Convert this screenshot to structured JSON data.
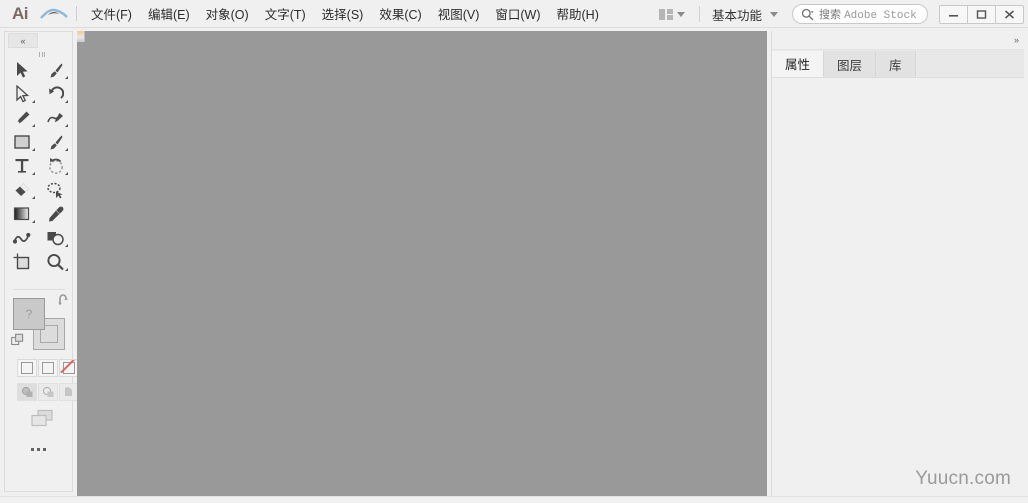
{
  "app": {
    "name": "Adobe Illustrator",
    "logo_text": "Ai"
  },
  "menubar": {
    "items": [
      {
        "label": "文件(F)",
        "name": "menu-file"
      },
      {
        "label": "编辑(E)",
        "name": "menu-edit"
      },
      {
        "label": "对象(O)",
        "name": "menu-object"
      },
      {
        "label": "文字(T)",
        "name": "menu-type"
      },
      {
        "label": "选择(S)",
        "name": "menu-select"
      },
      {
        "label": "效果(C)",
        "name": "menu-effect"
      },
      {
        "label": "视图(V)",
        "name": "menu-view"
      },
      {
        "label": "窗口(W)",
        "name": "menu-window"
      },
      {
        "label": "帮助(H)",
        "name": "menu-help"
      }
    ],
    "arrange_documents_label": "",
    "workspace": "基本功能",
    "search": {
      "placeholder": "搜索 Adobe Stock",
      "cn_part": "搜索",
      "en_part": "Adobe Stock",
      "value": ""
    },
    "window_controls": {
      "minimize": "—",
      "maximize": "□",
      "close": "✕"
    }
  },
  "toolbar": {
    "collapse_label": "«",
    "tools": [
      {
        "name": "selection-tool",
        "label": "选择工具"
      },
      {
        "name": "paintbrush-tool",
        "label": "画笔工具"
      },
      {
        "name": "direct-selection-tool",
        "label": "直接选择工具"
      },
      {
        "name": "rotate-tool",
        "label": "旋转工具"
      },
      {
        "name": "pen-tool",
        "label": "钢笔工具"
      },
      {
        "name": "pencil-tool",
        "label": "铅笔工具"
      },
      {
        "name": "rectangle-tool",
        "label": "矩形工具"
      },
      {
        "name": "paintbrush2-tool",
        "label": "斑点画笔工具"
      },
      {
        "name": "type-tool",
        "label": "文字工具"
      },
      {
        "name": "scale-tool",
        "label": "比例缩放工具"
      },
      {
        "name": "eraser-tool",
        "label": "橡皮擦工具"
      },
      {
        "name": "lasso-tool",
        "label": "套索工具"
      },
      {
        "name": "gradient-tool",
        "label": "渐变工具"
      },
      {
        "name": "eyedropper-tool",
        "label": "吸管工具"
      },
      {
        "name": "blend-tool",
        "label": "混合工具"
      },
      {
        "name": "shape-builder-tool",
        "label": "形状生成器工具"
      },
      {
        "name": "artboard-tool",
        "label": "画板工具"
      },
      {
        "name": "zoom-tool",
        "label": "缩放工具"
      }
    ],
    "fill_stroke": {
      "fill_label": "?",
      "stroke_label": "",
      "swap_label": "互换填色和描边",
      "default_label": "默认填色和描边"
    },
    "color_modes": [
      {
        "name": "color-mode-button",
        "label": "颜色"
      },
      {
        "name": "gradient-mode-button",
        "label": "渐变"
      },
      {
        "name": "none-mode-button",
        "label": "无"
      }
    ],
    "draw_modes": [
      {
        "name": "draw-normal-button",
        "label": "正常绘图"
      },
      {
        "name": "draw-behind-button",
        "label": "背面绘图"
      },
      {
        "name": "draw-inside-button",
        "label": "内部绘图"
      }
    ],
    "screen_mode_label": "更改屏幕模式",
    "more_tools_label": "编辑工具栏"
  },
  "canvas": {
    "background_color": "#999999",
    "document_tab_label": ""
  },
  "right_panel": {
    "expand_label": "»",
    "tabs": [
      {
        "label": "属性",
        "name": "tab-properties",
        "active": true
      },
      {
        "label": "图层",
        "name": "tab-layers",
        "active": false
      },
      {
        "label": "库",
        "name": "tab-libraries",
        "active": false
      }
    ]
  },
  "watermark": {
    "text": "Yuucn.com"
  },
  "colors": {
    "canvas": "#999999",
    "chrome": "#f0f0f0",
    "panel_active": "#f4f4f4",
    "accent_none": "#e06666"
  }
}
